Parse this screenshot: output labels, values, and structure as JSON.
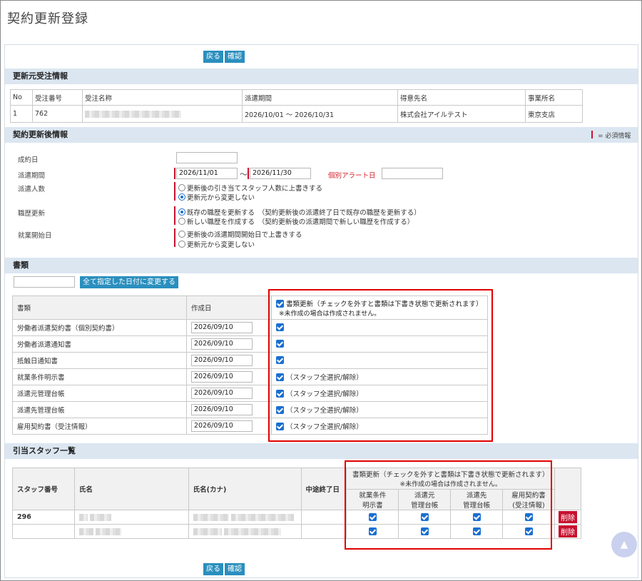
{
  "page_title": "契約更新登録",
  "buttons": {
    "back": "戻る",
    "confirm": "確認",
    "apply_date": "全て指定した日付に変更する",
    "delete": "削除"
  },
  "sections": {
    "source_order": "更新元受注情報",
    "after_update": "契約更新後情報",
    "documents": "書類",
    "staff": "引当スタッフ一覧"
  },
  "required_legend": "= 必須情報",
  "source_table": {
    "headers": [
      "No",
      "受注番号",
      "受注名称",
      "派遣期間",
      "得意先名",
      "事業所名"
    ],
    "row": {
      "no": "1",
      "order_no": "762",
      "period": "2026/10/01 〜 2026/10/31",
      "customer": "株式会社アイルテスト",
      "office": "東京支店"
    }
  },
  "form": {
    "contract_date_label": "成約日",
    "contract_date_value": "",
    "period_label": "派遣期間",
    "period_start": "2026/11/01",
    "period_tilde": "〜",
    "period_end": "2026/11/30",
    "alert_label": "個別アラート日",
    "alert_value": "",
    "headcount_label": "派遣人数",
    "headcount_opt1": "更新後の引き当てスタッフ人数に上書きする",
    "headcount_opt2": "更新元から変更しない",
    "history_label": "職歴更新",
    "history_opt1": "既存の職歴を更新する　（契約更新後の派遣終了日で既存の職歴を更新する）",
    "history_opt2": "新しい職歴を作成する　（契約更新後の派遣期間で新しい職歴を作成する）",
    "start_label": "就業開始日",
    "start_opt1": "更新後の派遣期間開始日で上書きする",
    "start_opt2": "更新元から変更しない"
  },
  "documents": {
    "bulk_date": "",
    "headers": {
      "doc": "書類",
      "date": "作成日",
      "update_line1": "書類更新（チェックを外すと書類は下書き状態で更新されます）",
      "update_line2": "※未作成の場合は作成されません。"
    },
    "select_all": "（スタッフ全選択/解除）",
    "rows": [
      {
        "name": "労働者派遣契約書（個別契約書）",
        "date": "2026/09/10"
      },
      {
        "name": "労働者派遣通知書",
        "date": "2026/09/10"
      },
      {
        "name": "抵触日通知書",
        "date": "2026/09/10"
      },
      {
        "name": "就業条件明示書",
        "date": "2026/09/10"
      },
      {
        "name": "派遣元管理台帳",
        "date": "2026/09/10"
      },
      {
        "name": "派遣先管理台帳",
        "date": "2026/09/10"
      },
      {
        "name": "雇用契約書（受注情報）",
        "date": "2026/09/10"
      }
    ]
  },
  "staff_table": {
    "headers": {
      "staff_no": "スタッフ番号",
      "name": "氏名",
      "kana": "氏名(カナ)",
      "mid_end": "中途終了日",
      "update_line1": "書類更新（チェックを外すと書類は下書き状態で更新されます）",
      "update_line2": "※未作成の場合は作成されません。"
    },
    "doc_cols": [
      {
        "l1": "就業条件",
        "l2": "明示書"
      },
      {
        "l1": "派遣元",
        "l2": "管理台帳"
      },
      {
        "l1": "派遣先",
        "l2": "管理台帳"
      },
      {
        "l1": "雇用契約書",
        "l2": "(受注情報)"
      }
    ],
    "rows": [
      {
        "staff_no": "296"
      },
      {
        "staff_no": ""
      }
    ]
  },
  "scroll_top_icon": "▲"
}
